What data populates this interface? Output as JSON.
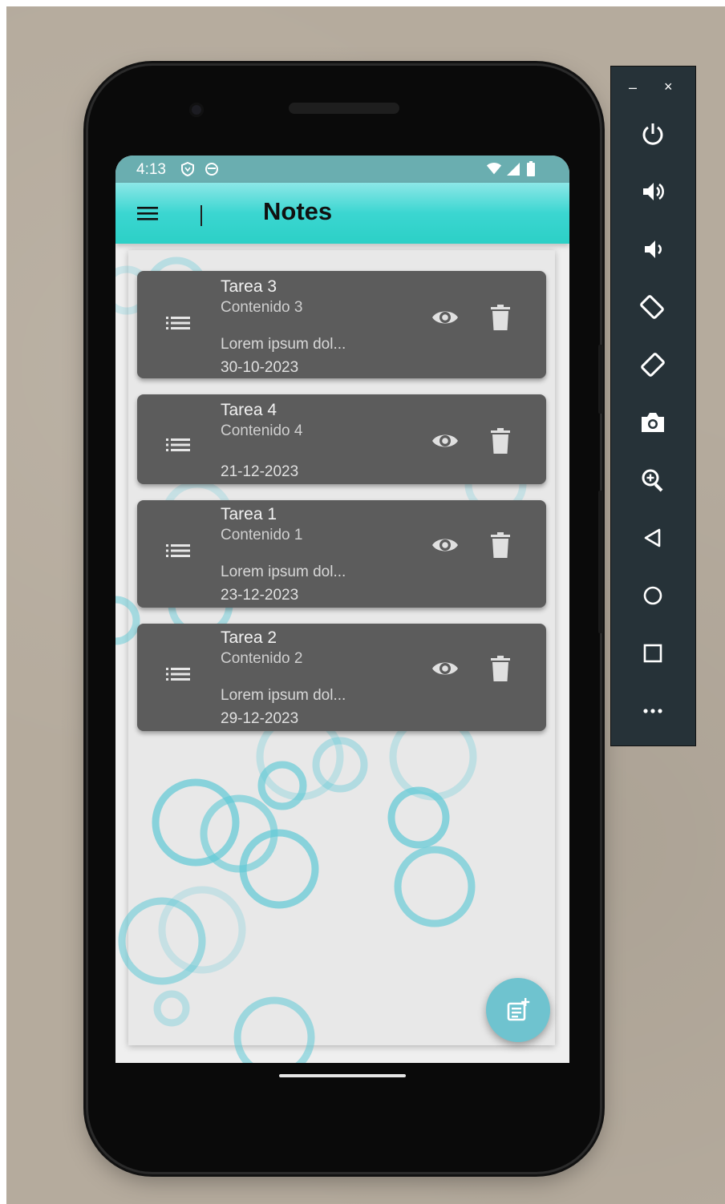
{
  "status_bar": {
    "time": "4:13",
    "icons": [
      "shield-icon",
      "sync-icon",
      "wifi-icon",
      "signal-icon",
      "battery-icon"
    ]
  },
  "app_bar": {
    "title": "Notes",
    "menu_icon": "menu-icon"
  },
  "notes": [
    {
      "title": "Tarea 3",
      "content": "Contenido 3",
      "description": "Lorem ipsum dol...",
      "date": "30-10-2023"
    },
    {
      "title": "Tarea 4",
      "content": "Contenido 4",
      "description": "",
      "date": "21-12-2023"
    },
    {
      "title": "Tarea 1",
      "content": "Contenido 1",
      "description": "Lorem ipsum dol...",
      "date": "23-12-2023"
    },
    {
      "title": "Tarea 2",
      "content": "Contenido 2",
      "description": "Lorem ipsum dol...",
      "date": "29-12-2023"
    }
  ],
  "fab": {
    "icon": "add-note-icon"
  },
  "emulator_toolbar": {
    "minimize": "–",
    "close": "×",
    "buttons": [
      "power-icon",
      "volume-up-icon",
      "volume-down-icon",
      "rotate-left-icon",
      "rotate-right-icon",
      "camera-icon",
      "zoom-icon",
      "back-icon",
      "home-icon",
      "overview-icon",
      "more-icon"
    ]
  },
  "colors": {
    "app_bar": "#2cd0c6",
    "status_bar": "#6aaeb0",
    "card": "#5c5c5c",
    "fab": "#6fc3cf",
    "bubble": "#5fc9d6"
  }
}
